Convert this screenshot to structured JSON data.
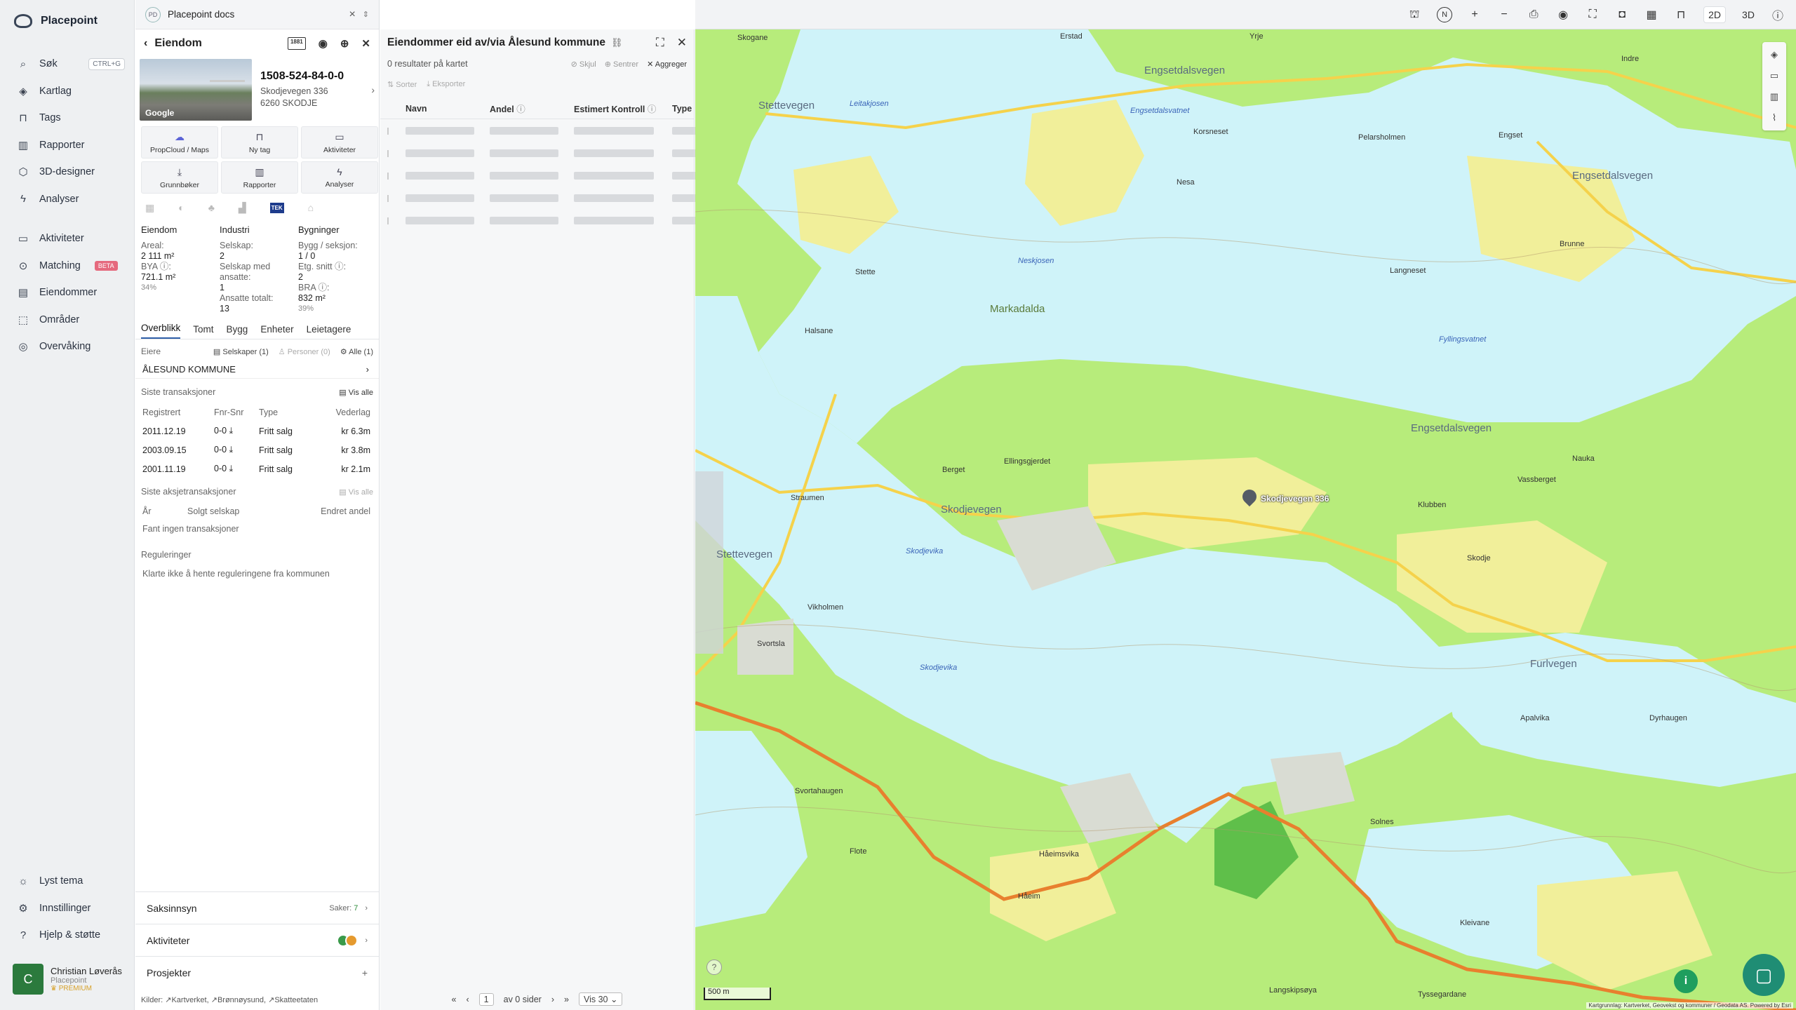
{
  "app": {
    "brand": "Placepoint"
  },
  "nav": {
    "items": [
      {
        "label": "Søk",
        "kbd": "CTRL+G",
        "icon": "search-icon"
      },
      {
        "label": "Kartlag",
        "icon": "layers-icon"
      },
      {
        "label": "Tags",
        "icon": "bookmark-icon"
      },
      {
        "label": "Rapporter",
        "icon": "chart-icon"
      },
      {
        "label": "3D-designer",
        "icon": "cube-icon"
      },
      {
        "label": "Analyser",
        "icon": "bolt-icon"
      }
    ],
    "items2": [
      {
        "label": "Aktiviteter",
        "icon": "chat-icon"
      },
      {
        "label": "Matching",
        "badge": "BETA",
        "icon": "match-icon"
      },
      {
        "label": "Eiendommer",
        "icon": "building-icon"
      },
      {
        "label": "Områder",
        "icon": "area-icon"
      },
      {
        "label": "Overvåking",
        "icon": "watch-icon"
      }
    ],
    "bottom": [
      {
        "label": "Lyst tema",
        "icon": "sun-icon"
      },
      {
        "label": "Innstillinger",
        "icon": "gear-icon"
      },
      {
        "label": "Hjelp & støtte",
        "icon": "help-icon"
      }
    ],
    "user": {
      "initial": "C",
      "name": "Christian Løverås",
      "org": "Placepoint",
      "plan": "PREMIUM"
    }
  },
  "docs": {
    "badge": "PD",
    "title": "Placepoint docs"
  },
  "property": {
    "header": "Eiendom",
    "btag": "1881",
    "thumb_label": "Google",
    "id": "1508-524-84-0-0",
    "address1": "Skodjevegen 336",
    "address2": "6260 SKODJE",
    "buttons": [
      {
        "label": "PropCloud / Maps",
        "icon": "cloud-icon"
      },
      {
        "label": "Ny tag",
        "icon": "bookmark-icon"
      },
      {
        "label": "Aktiviteter",
        "icon": "chat-icon"
      },
      {
        "label": "Grunnbøker",
        "icon": "download-icon"
      },
      {
        "label": "Rapporter",
        "icon": "chart-icon"
      },
      {
        "label": "Analyser",
        "icon": "bolt-icon"
      }
    ],
    "tek": "TEK",
    "eiendom": {
      "h": "Eiendom",
      "areal_k": "Areal:",
      "areal_v": "2 111 m²",
      "bya_k": "BYA ⓘ:",
      "bya_v": "721.1 m²",
      "bya_p": "34%"
    },
    "industri": {
      "h": "Industri",
      "selskap_k": "Selskap:",
      "selskap_v": "2",
      "ansatte_k": "Selskap med ansatte:",
      "ansatte_v": "1",
      "tot_k": "Ansatte totalt:",
      "tot_v": "13"
    },
    "bygninger": {
      "h": "Bygninger",
      "bygg_k": "Bygg / seksjon:",
      "bygg_v": "1 / 0",
      "etg_k": "Etg. snitt ⓘ:",
      "etg_v": "2",
      "bra_k": "BRA ⓘ:",
      "bra_v": "832 m²",
      "bra_p": "39%"
    },
    "tabs": [
      "Overblikk",
      "Tomt",
      "Bygg",
      "Enheter",
      "Leietagere"
    ],
    "eiere_label": "Eiere",
    "eiere_filters": [
      "Selskaper (1)",
      "Personer (0)",
      "Alle (1)"
    ],
    "owner": "ÅLESUND KOMMUNE",
    "trans_title": "Siste transaksjoner",
    "vis_alle": "Vis alle",
    "trans_head": [
      "Registrert",
      "Fnr-Snr",
      "Type",
      "Vederlag"
    ],
    "trans": [
      {
        "date": "2011.12.19",
        "fnr": "0-0",
        "type": "Fritt salg",
        "amount": "kr 6.3m"
      },
      {
        "date": "2003.09.15",
        "fnr": "0-0",
        "type": "Fritt salg",
        "amount": "kr 3.8m"
      },
      {
        "date": "2001.11.19",
        "fnr": "0-0",
        "type": "Fritt salg",
        "amount": "kr 2.1m"
      }
    ],
    "aksje_title": "Siste aksjetransaksjoner",
    "aksje_head": [
      "År",
      "Solgt selskap",
      "Endret andel"
    ],
    "aksje_empty": "Fant ingen transaksjoner",
    "reg_title": "Reguleringer",
    "reg_note": "Klarte ikke å hente reguleringene fra kommunen",
    "saksinnsyn": "Saksinnsyn",
    "saker": "Saker:",
    "saker_count": "7",
    "aktiviteter": "Aktiviteter",
    "prosjekter": "Prosjekter",
    "kilder": "Kilder:",
    "kilder_items": [
      "Kartverket",
      "Brønnøysund",
      "Skatteetaten"
    ]
  },
  "results": {
    "title": "Eiendommer eid av/via Ålesund kommune",
    "count": "0 resultater på kartet",
    "actions": [
      "Skjul",
      "Sentrer",
      "Aggreger"
    ],
    "tools": [
      "Sorter",
      "Eksporter"
    ],
    "columns": [
      "Navn",
      "Andel",
      "Estimert Kontroll",
      "Type"
    ],
    "page": "1",
    "of_pages": "av 0 sider",
    "per_page": "Vis 30"
  },
  "map": {
    "mode_2d": "2D",
    "mode_3d": "3D",
    "compass": "N",
    "pin_label": "Skodjevegen 336",
    "scale": "500 m",
    "attribution": "Kartgrunnlag: Kartverket, Geovekst og kommuner / Geodata AS. Powered by Esri",
    "labels": [
      {
        "t": "Skogane",
        "c": ""
      },
      {
        "t": "Erstad",
        "c": ""
      },
      {
        "t": "Yrje",
        "c": ""
      },
      {
        "t": "Indre",
        "c": ""
      },
      {
        "t": "Engsetdalsvegen",
        "c": "r"
      },
      {
        "t": "Engsetdalsvatnet",
        "c": "w"
      },
      {
        "t": "Stettevegen",
        "c": "r"
      },
      {
        "t": "Leitakjosen",
        "c": "w"
      },
      {
        "t": "Engset",
        "c": ""
      },
      {
        "t": "Engsetdalsvegen",
        "c": "r"
      },
      {
        "t": "Korsneset",
        "c": ""
      },
      {
        "t": "Pelarsholmen",
        "c": ""
      },
      {
        "t": "Neskjosen",
        "c": "w"
      },
      {
        "t": "Markadalda",
        "c": "r"
      },
      {
        "t": "Langneset",
        "c": ""
      },
      {
        "t": "Fyllingsvatnet",
        "c": "w"
      },
      {
        "t": "Skodjevegen",
        "c": "r"
      },
      {
        "t": "Skodjevika",
        "c": "w"
      },
      {
        "t": "Engsetdalsvegen",
        "c": "r"
      },
      {
        "t": "Skodje",
        "c": ""
      },
      {
        "t": "Furlvegen",
        "c": "r"
      },
      {
        "t": "Skodjevika",
        "c": "w"
      },
      {
        "t": "Solnes",
        "c": ""
      },
      {
        "t": "Stettevegen",
        "c": "r"
      },
      {
        "t": "Håeimsvika",
        "c": ""
      },
      {
        "t": "Tyssegardane",
        "c": ""
      },
      {
        "t": "Langskipsøya",
        "c": ""
      },
      {
        "t": "Vikholmen",
        "c": ""
      },
      {
        "t": "Svortsla",
        "c": ""
      },
      {
        "t": "Straumen",
        "c": ""
      },
      {
        "t": "Svortahaugen",
        "c": ""
      },
      {
        "t": "Ellingsgjerdet",
        "c": ""
      },
      {
        "t": "Berget",
        "c": ""
      },
      {
        "t": "Klubben",
        "c": ""
      },
      {
        "t": "Vassberget",
        "c": ""
      },
      {
        "t": "Nauka",
        "c": ""
      },
      {
        "t": "Brunne",
        "c": ""
      },
      {
        "t": "Stette",
        "c": ""
      },
      {
        "t": "Halsane",
        "c": ""
      },
      {
        "t": "Nesa",
        "c": ""
      },
      {
        "t": "Dyrhaugen",
        "c": ""
      },
      {
        "t": "Apalvika",
        "c": ""
      },
      {
        "t": "Flote",
        "c": ""
      },
      {
        "t": "Håeim",
        "c": ""
      },
      {
        "t": "Kleivane",
        "c": ""
      }
    ]
  }
}
